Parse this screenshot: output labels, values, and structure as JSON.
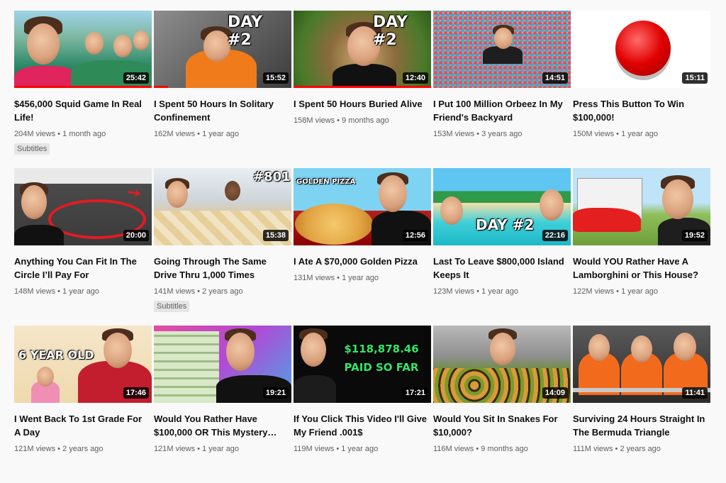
{
  "videos": [
    {
      "title": "$456,000 Squid Game In Real Life!",
      "views": "204M views",
      "age": "1 month ago",
      "duration": "25:42",
      "badge": "Subtitles",
      "overlay": ""
    },
    {
      "title": "I Spent 50 Hours In Solitary Confinement",
      "views": "162M views",
      "age": "1 year ago",
      "duration": "15:52",
      "badge": "",
      "overlay": "DAY #2"
    },
    {
      "title": "I Spent 50 Hours Buried Alive",
      "views": "158M views",
      "age": "9 months ago",
      "duration": "12:40",
      "badge": "",
      "overlay": "DAY #2"
    },
    {
      "title": "I Put 100 Million Orbeez In My Friend's Backyard",
      "views": "153M views",
      "age": "3 years ago",
      "duration": "14:51",
      "badge": "",
      "overlay": ""
    },
    {
      "title": "Press This Button To Win $100,000!",
      "views": "150M views",
      "age": "1 year ago",
      "duration": "15:11",
      "badge": "",
      "overlay": ""
    },
    {
      "title": "Anything You Can Fit In The Circle I’ll Pay For",
      "views": "148M views",
      "age": "1 year ago",
      "duration": "20:00",
      "badge": "",
      "overlay": ""
    },
    {
      "title": "Going Through The Same Drive Thru 1,000 Times",
      "views": "141M views",
      "age": "2 years ago",
      "duration": "15:38",
      "badge": "Subtitles",
      "overlay": "#801"
    },
    {
      "title": "I Ate A $70,000 Golden Pizza",
      "views": "131M views",
      "age": "1 year ago",
      "duration": "12:56",
      "badge": "",
      "overlay": "GOLDEN PIZZA"
    },
    {
      "title": "Last To Leave $800,000 Island Keeps It",
      "views": "123M views",
      "age": "1 year ago",
      "duration": "22:16",
      "badge": "",
      "overlay": "DAY #2"
    },
    {
      "title": "Would YOU Rather Have A Lamborghini or This House?",
      "views": "122M views",
      "age": "1 year ago",
      "duration": "19:52",
      "badge": "",
      "overlay": ""
    },
    {
      "title": "I Went Back To 1st Grade For A Day",
      "views": "121M views",
      "age": "2 years ago",
      "duration": "17:46",
      "badge": "",
      "overlay": "6 YEAR OLD"
    },
    {
      "title": "Would You Rather Have $100,000 OR This Mystery…",
      "views": "121M views",
      "age": "1 year ago",
      "duration": "19:21",
      "badge": "",
      "overlay": ""
    },
    {
      "title": "If You Click This Video I'll Give My Friend .001$",
      "views": "119M views",
      "age": "1 year ago",
      "duration": "17:21",
      "badge": "",
      "overlay": "$118,878.46 PAID SO FAR"
    },
    {
      "title": "Would You Sit In Snakes For $10,000?",
      "views": "116M views",
      "age": "9 months ago",
      "duration": "14:09",
      "badge": "",
      "overlay": ""
    },
    {
      "title": "Surviving 24 Hours Straight In The Bermuda Triangle",
      "views": "111M views",
      "age": "2 years ago",
      "duration": "11:41",
      "badge": "",
      "overlay": ""
    }
  ],
  "separator": "•"
}
